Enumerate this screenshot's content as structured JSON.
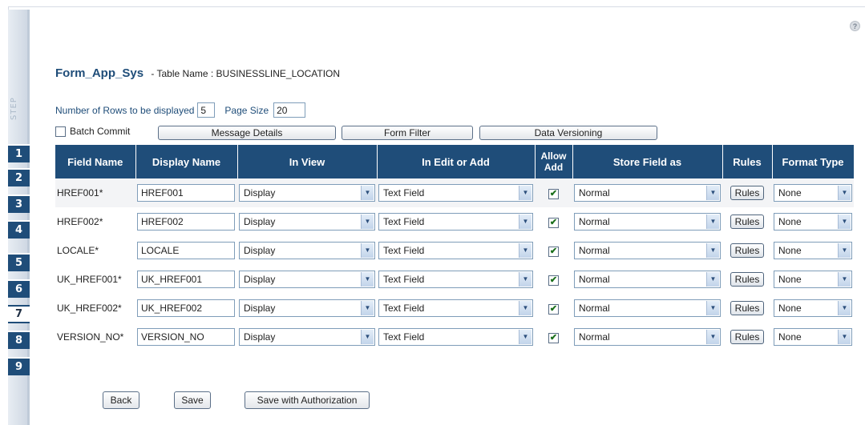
{
  "help_icon": "?",
  "step_rail": {
    "label": "STEP",
    "tabs": [
      "1",
      "2",
      "3",
      "4",
      "5",
      "6",
      "7",
      "8",
      "9"
    ],
    "active_tab": "7"
  },
  "header": {
    "form_name": "Form_App_Sys",
    "table_label": "- Table Name : BUSINESSLINE_LOCATION"
  },
  "rows_settings": {
    "rows_label": "Number of Rows to be displayed",
    "rows_value": "5",
    "page_size_label": "Page Size",
    "page_size_value": "20"
  },
  "toolbar": {
    "batch_commit_label": "Batch Commit",
    "batch_commit_checked": false,
    "message_details": "Message Details",
    "form_filter": "Form Filter",
    "data_versioning": "Data Versioning"
  },
  "table": {
    "headers": {
      "field_name": "Field Name",
      "display_name": "Display Name",
      "in_view": "In View",
      "in_edit_or_add": "In Edit or Add",
      "allow_add_1": "Allow",
      "allow_add_2": "Add",
      "store_field_as": "Store Field as",
      "rules": "Rules",
      "format_type": "Format Type"
    },
    "rows": [
      {
        "field": "HREF001*",
        "display": "HREF001",
        "in_view": "Display",
        "in_edit": "Text Field",
        "allow_add": true,
        "store_as": "Normal",
        "rules": "Rules",
        "format": "None"
      },
      {
        "field": "HREF002*",
        "display": "HREF002",
        "in_view": "Display",
        "in_edit": "Text Field",
        "allow_add": true,
        "store_as": "Normal",
        "rules": "Rules",
        "format": "None"
      },
      {
        "field": "LOCALE*",
        "display": "LOCALE",
        "in_view": "Display",
        "in_edit": "Text Field",
        "allow_add": true,
        "store_as": "Normal",
        "rules": "Rules",
        "format": "None"
      },
      {
        "field": "UK_HREF001*",
        "display": "UK_HREF001",
        "in_view": "Display",
        "in_edit": "Text Field",
        "allow_add": true,
        "store_as": "Normal",
        "rules": "Rules",
        "format": "None"
      },
      {
        "field": "UK_HREF002*",
        "display": "UK_HREF002",
        "in_view": "Display",
        "in_edit": "Text Field",
        "allow_add": true,
        "store_as": "Normal",
        "rules": "Rules",
        "format": "None"
      },
      {
        "field": "VERSION_NO*",
        "display": "VERSION_NO",
        "in_view": "Display",
        "in_edit": "Text Field",
        "allow_add": true,
        "store_as": "Normal",
        "rules": "Rules",
        "format": "None"
      }
    ]
  },
  "footer": {
    "back": "Back",
    "save": "Save",
    "save_with_authorization": "Save with Authorization"
  },
  "icons": {
    "check": "✔",
    "dropdown": "▼"
  },
  "colors": {
    "header_bg": "#1f4d79",
    "title": "#1f4d79",
    "rail_bg": "#dfe5ec"
  }
}
